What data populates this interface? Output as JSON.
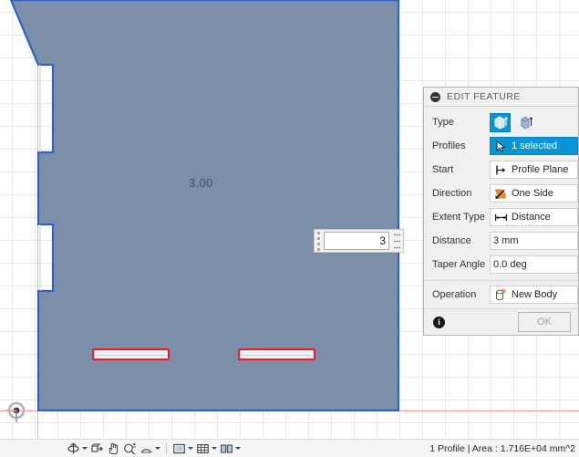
{
  "canvas": {
    "dimension_label": "3.00",
    "value_input": {
      "value": "3",
      "placeholder": "3"
    },
    "origin_name": "sketch-origin"
  },
  "dialog": {
    "title": "EDIT FEATURE",
    "rows": [
      {
        "label": "Type",
        "control": "type-toggle",
        "options": [
          "extrude-profile",
          "extrude-surface"
        ],
        "selected_index": 0
      },
      {
        "label": "Profiles",
        "control": "selection",
        "value": "1 selected",
        "icon": "cursor-arrow-icon",
        "highlighted": true
      },
      {
        "label": "Start",
        "control": "dropdown",
        "value": "Profile Plane",
        "icon": "profile-plane-icon"
      },
      {
        "label": "Direction",
        "control": "dropdown",
        "value": "One Side",
        "icon": "one-side-arrow-icon"
      },
      {
        "label": "Extent Type",
        "control": "dropdown",
        "value": "Distance",
        "icon": "distance-arrows-icon"
      },
      {
        "label": "Distance",
        "control": "textbox",
        "value": "3 mm"
      },
      {
        "label": "Taper Angle",
        "control": "textbox",
        "value": "0.0 deg"
      }
    ],
    "operation": {
      "label": "Operation",
      "value": "New Body",
      "icon": "new-body-icon"
    },
    "footer": {
      "info_label": "i",
      "ok_label": "OK"
    }
  },
  "bottom_bar": {
    "tools": [
      {
        "name": "orbit-tool",
        "icon": "orbit-icon",
        "has_caret": true
      },
      {
        "name": "look-at-tool",
        "icon": "look-at-icon",
        "has_caret": false
      },
      {
        "name": "pan-tool",
        "icon": "pan-hand-icon",
        "has_caret": false
      },
      {
        "name": "zoom-tool",
        "icon": "zoom-icon",
        "has_caret": false
      },
      {
        "name": "fit-tool",
        "icon": "fit-icon",
        "has_caret": true
      },
      {
        "name": "display-settings",
        "icon": "display-icon",
        "has_caret": true
      },
      {
        "name": "grid-snaps",
        "icon": "grid-icon",
        "has_caret": true
      },
      {
        "name": "viewports",
        "icon": "viewports-icon",
        "has_caret": true
      }
    ],
    "status_text": "1 Profile | Area : 1.716E+04 mm^2"
  },
  "colors": {
    "body_fill": "#7b8fa8",
    "body_edge": "#2c62c4",
    "accent_blue": "#0696d7",
    "slot_outline": "#ee1c1c",
    "axis_x": "#f09a9a",
    "axis_y": "#b9c2e8"
  }
}
